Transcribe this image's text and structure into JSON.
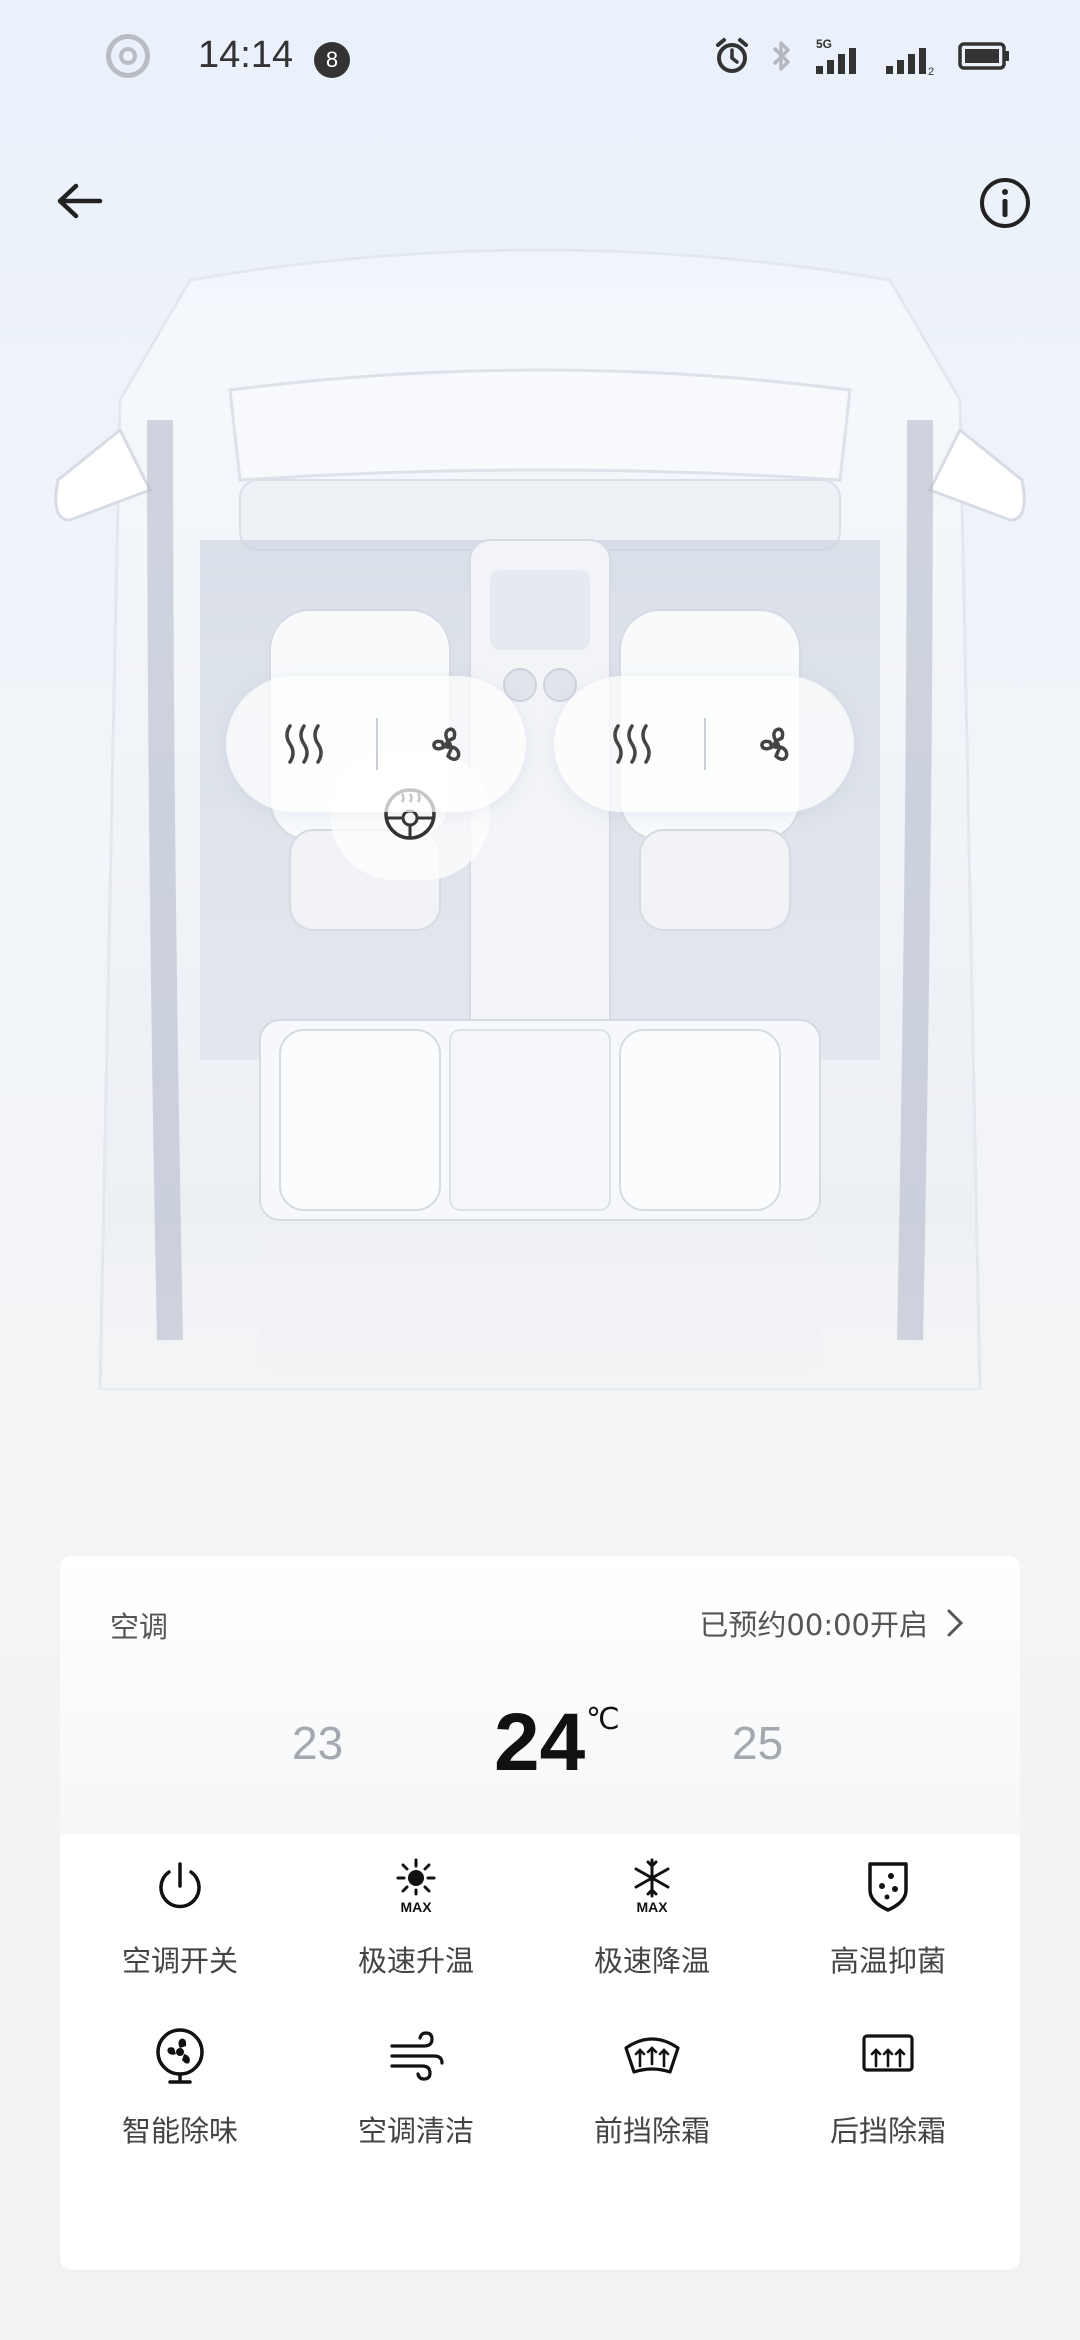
{
  "status_bar": {
    "time": "14:14",
    "notification_count": "8",
    "network_label": "5G",
    "sim2_label": "2"
  },
  "climate": {
    "title": "空调",
    "schedule_text": "已预约00:00开启",
    "temp_lower": "23",
    "temp_current": "24",
    "temp_unit": "℃",
    "temp_higher": "25"
  },
  "functions": [
    {
      "label": "空调开关",
      "icon": "power-icon"
    },
    {
      "label": "极速升温",
      "icon": "sun-max-icon"
    },
    {
      "label": "极速降温",
      "icon": "snowflake-max-icon"
    },
    {
      "label": "高温抑菌",
      "icon": "shield-dots-icon"
    },
    {
      "label": "智能除味",
      "icon": "fan-icon"
    },
    {
      "label": "空调清洁",
      "icon": "wind-icon"
    },
    {
      "label": "前挡除霜",
      "icon": "front-defrost-icon"
    },
    {
      "label": "后挡除霜",
      "icon": "rear-defrost-icon"
    }
  ],
  "icon_max_label": "MAX"
}
